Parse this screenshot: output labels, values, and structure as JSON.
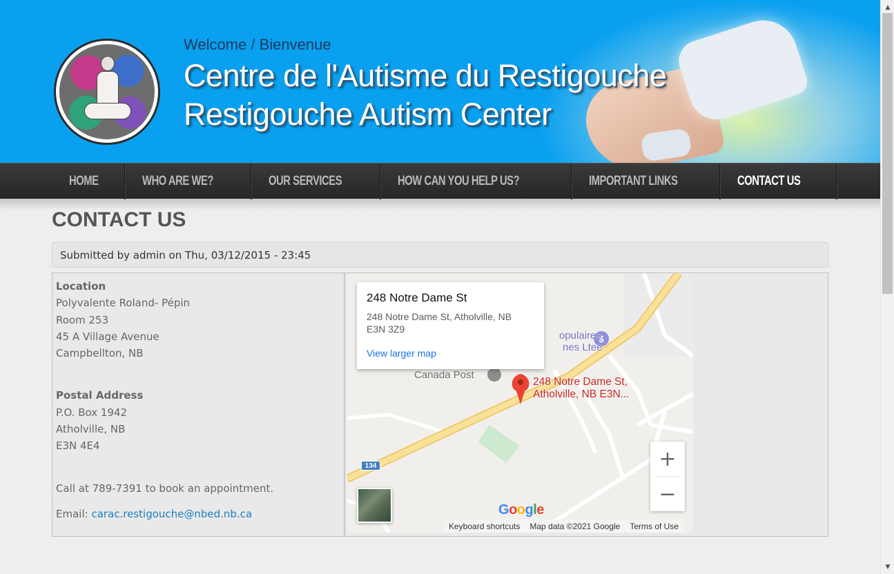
{
  "header": {
    "welcome": "Welcome / Bienvenue",
    "title_fr": "Centre de l'Autisme du Restigouche",
    "title_en": "Restigouche Autism Center"
  },
  "nav": {
    "items": [
      {
        "label": "HOME",
        "active": false
      },
      {
        "label": "WHO ARE WE?",
        "active": false
      },
      {
        "label": "OUR SERVICES",
        "active": false
      },
      {
        "label": "HOW CAN YOU HELP US?",
        "active": false
      },
      {
        "label": "IMPORTANT LINKS",
        "active": false
      },
      {
        "label": "CONTACT US",
        "active": true
      }
    ]
  },
  "page": {
    "title": "CONTACT US",
    "submitted": "Submitted by admin on Thu, 03/12/2015 - 23:45"
  },
  "contact": {
    "location_heading": "Location",
    "location_lines": [
      "Polyvalente Roland- Pépin",
      "Room 253",
      "45 A Village Avenue",
      "Campbellton, NB"
    ],
    "postal_heading": "Postal Address",
    "postal_lines": [
      "P.O. Box 1942",
      "Atholville, NB",
      "E3N 4E4"
    ],
    "call_text": "Call at 789-7391 to book an appointment.",
    "email_label": "Email: ",
    "email": "carac.restigouche@nbed.nb.ca"
  },
  "map": {
    "info_title": "248 Notre Dame St",
    "info_address": "248 Notre Dame St, Atholville, NB E3N 3Z9",
    "info_link": "View larger map",
    "marker_label": "248 Notre Dame St, Atholville, NB E3N...",
    "poi_post": "Canada Post",
    "poi_bank_line1": "opulaires",
    "poi_bank_line2": "nes Ltee",
    "route_number": "134",
    "zoom_in": "+",
    "zoom_out": "−",
    "attribution": [
      "Keyboard shortcuts",
      "Map data ©2021 Google",
      "Terms of Use"
    ],
    "logo_letters": [
      "G",
      "o",
      "o",
      "g",
      "l",
      "e"
    ]
  },
  "scrollbar": {
    "up": "▲",
    "down": "▼"
  }
}
